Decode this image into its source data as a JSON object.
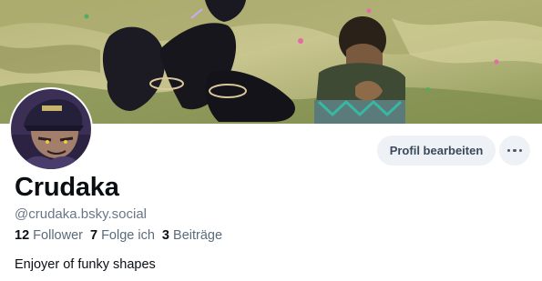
{
  "profile": {
    "display_name": "Crudaka",
    "handle": "@crudaka.bsky.social",
    "bio": "Enjoyer of funky shapes",
    "stats": {
      "followers_count": "12",
      "followers_label": "Follower",
      "following_count": "7",
      "following_label": "Folge ich",
      "posts_count": "3",
      "posts_label": "Beiträge"
    }
  },
  "actions": {
    "edit_profile_label": "Profil bearbeiten",
    "more_icon": "ellipsis-horizontal-icon"
  },
  "colors": {
    "button_bg": "#eef1f5",
    "muted_text": "#6a7686"
  }
}
